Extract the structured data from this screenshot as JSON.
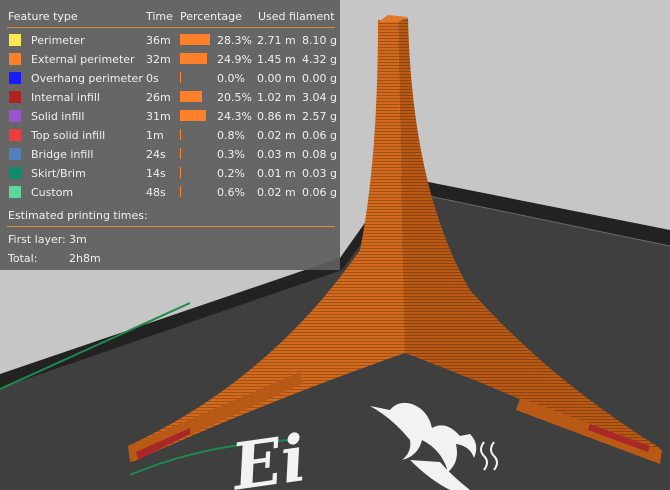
{
  "colors": {
    "accent": "#e08a3c",
    "model": "#d36a1e",
    "bar": "#ff7f2a"
  },
  "legend": {
    "headers": {
      "feature": "Feature type",
      "time": "Time",
      "percentage": "Percentage",
      "filament": "Used filament"
    },
    "rows": [
      {
        "color": "#ffe84d",
        "feature": "Perimeter",
        "time": "36m",
        "pct": 0.283,
        "pct_label": "28.3%",
        "length": "2.71 m",
        "weight": "8.10 g"
      },
      {
        "color": "#ff7f2a",
        "feature": "External perimeter",
        "time": "32m",
        "pct": 0.249,
        "pct_label": "24.9%",
        "length": "1.45 m",
        "weight": "4.32 g"
      },
      {
        "color": "#1a1aff",
        "feature": "Overhang perimeter",
        "time": "0s",
        "pct": 0.0,
        "pct_label": "0.0%",
        "length": "0.00 m",
        "weight": "0.00 g"
      },
      {
        "color": "#b22222",
        "feature": "Internal infill",
        "time": "26m",
        "pct": 0.205,
        "pct_label": "20.5%",
        "length": "1.02 m",
        "weight": "3.04 g"
      },
      {
        "color": "#9955cc",
        "feature": "Solid infill",
        "time": "31m",
        "pct": 0.243,
        "pct_label": "24.3%",
        "length": "0.86 m",
        "weight": "2.57 g"
      },
      {
        "color": "#f03c3c",
        "feature": "Top solid infill",
        "time": "1m",
        "pct": 0.008,
        "pct_label": "0.8%",
        "length": "0.02 m",
        "weight": "0.06 g"
      },
      {
        "color": "#5080c0",
        "feature": "Bridge infill",
        "time": "24s",
        "pct": 0.003,
        "pct_label": "0.3%",
        "length": "0.03 m",
        "weight": "0.08 g"
      },
      {
        "color": "#0d8c6e",
        "feature": "Skirt/Brim",
        "time": "14s",
        "pct": 0.002,
        "pct_label": "0.2%",
        "length": "0.01 m",
        "weight": "0.03 g"
      },
      {
        "color": "#5ed69a",
        "feature": "Custom",
        "time": "48s",
        "pct": 0.006,
        "pct_label": "0.6%",
        "length": "0.02 m",
        "weight": "0.06 g"
      }
    ],
    "estimated_label": "Estimated printing times:",
    "first_layer_label": "First layer:",
    "first_layer_value": "3m",
    "total_label": "Total:",
    "total_value": "2h8m"
  },
  "bed": {
    "logo_text": "Ei"
  }
}
